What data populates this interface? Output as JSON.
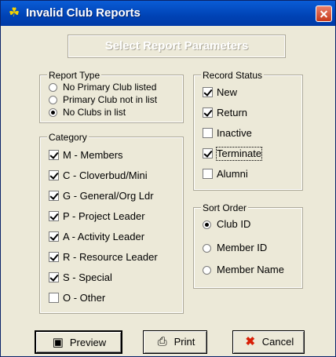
{
  "window": {
    "title": "Invalid Club Reports",
    "title_icon": "clover-icon",
    "close_icon": "close-icon"
  },
  "banner": "Select Report Parameters",
  "report_type": {
    "legend": "Report Type",
    "options": [
      {
        "label": "No Primary Club listed",
        "selected": false
      },
      {
        "label": "Primary Club not in list",
        "selected": false
      },
      {
        "label": "No Clubs in list",
        "selected": true
      }
    ]
  },
  "category": {
    "legend": "Category",
    "items": [
      {
        "label": "M - Members",
        "checked": true
      },
      {
        "label": "C - Cloverbud/Mini",
        "checked": true
      },
      {
        "label": "G - General/Org Ldr",
        "checked": true
      },
      {
        "label": "P - Project Leader",
        "checked": true
      },
      {
        "label": "A - Activity Leader",
        "checked": true
      },
      {
        "label": "R - Resource Leader",
        "checked": true
      },
      {
        "label": "S - Special",
        "checked": true
      },
      {
        "label": "O - Other",
        "checked": false
      }
    ]
  },
  "record_status": {
    "legend": "Record Status",
    "items": [
      {
        "label": "New",
        "checked": true
      },
      {
        "label": "Return",
        "checked": true
      },
      {
        "label": "Inactive",
        "checked": false
      },
      {
        "label": "Terminate",
        "checked": true
      },
      {
        "label": "Alumni",
        "checked": false
      }
    ]
  },
  "sort_order": {
    "legend": "Sort Order",
    "options": [
      {
        "label": "Club ID",
        "selected": true
      },
      {
        "label": "Member ID",
        "selected": false
      },
      {
        "label": "Member Name",
        "selected": false
      }
    ]
  },
  "buttons": {
    "preview": {
      "label": "Preview",
      "icon": "preview-icon"
    },
    "print": {
      "label": "Print",
      "icon": "printer-icon"
    },
    "cancel": {
      "label": "Cancel",
      "icon": "red-x-icon"
    }
  }
}
